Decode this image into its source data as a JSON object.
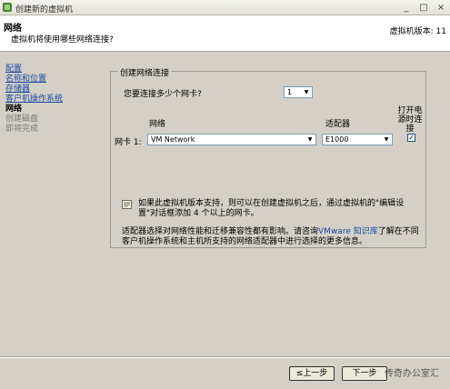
{
  "window": {
    "title": "创建新的虚拟机"
  },
  "header": {
    "title": "网络",
    "subtitle": "虚拟机将使用哪些网络连接?",
    "version": "虚拟机版本: 11"
  },
  "nav": {
    "items": [
      {
        "label": "配置",
        "state": "link"
      },
      {
        "label": "名称和位置",
        "state": "link"
      },
      {
        "label": "存储器",
        "state": "link"
      },
      {
        "label": "客户机操作系统",
        "state": "link"
      },
      {
        "label": "网络",
        "state": "current"
      },
      {
        "label": "创建磁盘",
        "state": "disabled"
      },
      {
        "label": "即将完成",
        "state": "disabled"
      }
    ]
  },
  "group": {
    "legend": "创建网络连接",
    "nic_count_label": "您要连接多少个网卡?",
    "nic_count_value": "1",
    "col_network": "网络",
    "col_adapter": "适配器",
    "col_power_on": "打开电源时连接",
    "nic_row": {
      "label": "网卡 1:",
      "network": "VM Network",
      "adapter": "E1000",
      "connect_at_power_on": true
    },
    "note": "如果此虚拟机版本支持，则可以在创建虚拟机之后，通过虚拟机的\"编辑设置\"对话框添加 4 个以上的网卡。",
    "adapter_info_prefix": "适配器选择对网络性能和迁移兼容性都有影响。请咨询",
    "adapter_info_link": "VMware 知识库",
    "adapter_info_suffix": "了解在不同客户机操作系统和主机所支持的网络适配器中进行选择的更多信息。"
  },
  "buttons": {
    "back": "≤上一步",
    "next": "下一步"
  },
  "watermark": "传奇办公室汇"
}
